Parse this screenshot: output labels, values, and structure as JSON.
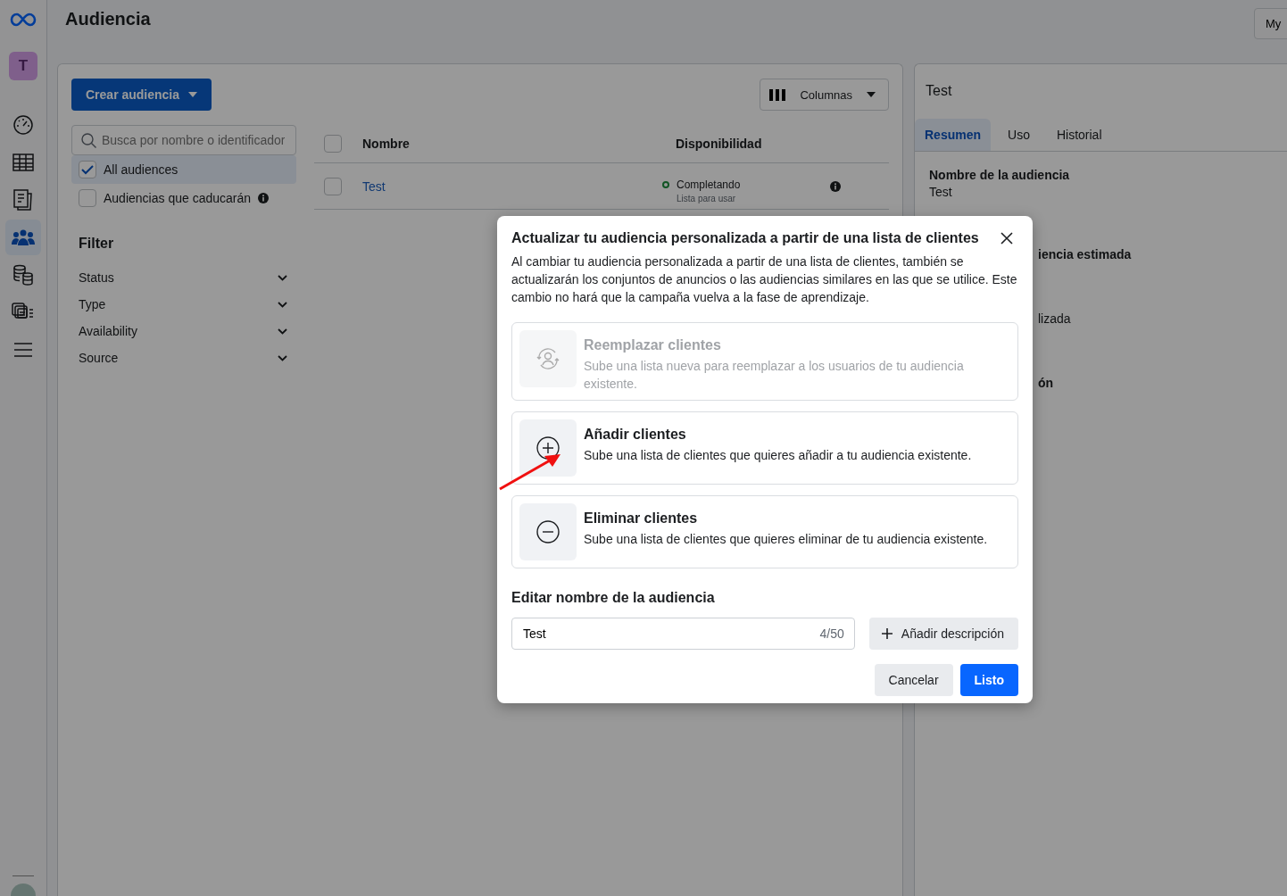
{
  "nav": {
    "account_initial": "T",
    "items": [
      {
        "kind": "dashboard",
        "selected": false
      },
      {
        "kind": "table",
        "selected": false
      },
      {
        "kind": "pages",
        "selected": false
      },
      {
        "kind": "people",
        "selected": true
      },
      {
        "kind": "database",
        "selected": false
      },
      {
        "kind": "catalog",
        "selected": false
      },
      {
        "kind": "menu",
        "selected": false
      }
    ]
  },
  "header": {
    "title": "Audiencia",
    "account_button": "My"
  },
  "toolbar": {
    "create_button": "Crear audiencia",
    "columns_button": "Columnas"
  },
  "search": {
    "placeholder": "Busca por nombre o identificador"
  },
  "audience_filters": [
    {
      "label": "All audiences",
      "checked": true,
      "selected": true,
      "info": false
    },
    {
      "label": "Audiencias que caducarán",
      "checked": false,
      "selected": false,
      "info": true
    }
  ],
  "filter": {
    "title": "Filter",
    "items": [
      "Status",
      "Type",
      "Availability",
      "Source"
    ]
  },
  "table": {
    "columns": [
      "Nombre",
      "Disponibilidad"
    ],
    "select_all_checked": false,
    "rows": [
      {
        "name": "Test",
        "checked": false,
        "status": "Completando",
        "status_note": "Lista para usar"
      }
    ]
  },
  "detail": {
    "title": "Test",
    "tabs": [
      {
        "label": "Resumen",
        "selected": true
      },
      {
        "label": "Uso",
        "selected": false
      },
      {
        "label": "Historial",
        "selected": false
      }
    ],
    "fields": [
      {
        "label": "Nombre de la audiencia",
        "value": "Test"
      }
    ],
    "partial_texts": [
      {
        "text": "iencia estimada",
        "bold": true
      },
      {
        "text": "lizada",
        "bold": false
      },
      {
        "text": "ón",
        "bold": true
      }
    ]
  },
  "dialog": {
    "title": "Actualizar tu audiencia personalizada a partir de una lista de clientes",
    "description": "Al cambiar tu audiencia personalizada a partir de una lista de clientes, también se actualizarán los conjuntos de anuncios o las audiencias similares en las que se utilice. Este cambio no hará que la campaña vuelva a la fase de aprendizaje.",
    "options": [
      {
        "kind": "replace",
        "title": "Reemplazar clientes",
        "text": "Sube una lista nueva para reemplazar a los usuarios de tu audiencia existente.",
        "disabled": true
      },
      {
        "kind": "add",
        "title": "Añadir clientes",
        "text": "Sube una lista de clientes que quieres añadir a tu audiencia existente.",
        "disabled": false
      },
      {
        "kind": "remove",
        "title": "Eliminar clientes",
        "text": "Sube una lista de clientes que quieres eliminar de tu audiencia existente.",
        "disabled": false
      }
    ],
    "name_label": "Editar nombre de la audiencia",
    "name_value": "Test",
    "name_count": "4/50",
    "add_description": "Añadir descripción",
    "cancel": "Cancelar",
    "done": "Listo"
  }
}
